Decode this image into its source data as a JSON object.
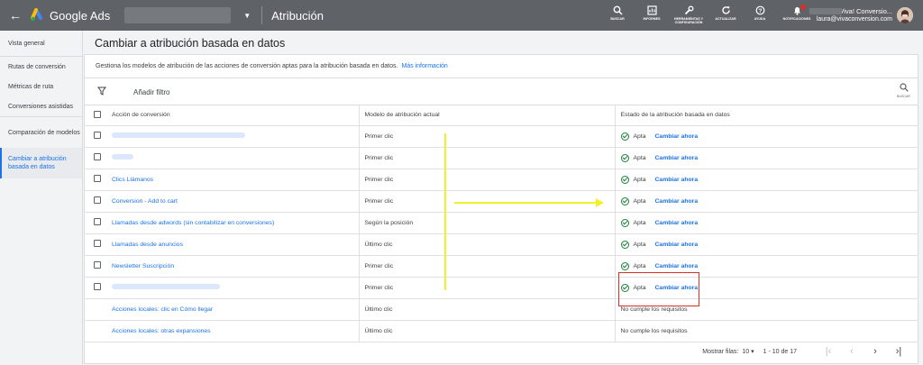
{
  "topbar": {
    "back_icon": "arrow-left-icon",
    "brand": "Google Ads",
    "section_title": "Atribución",
    "tools": [
      {
        "icon": "search-icon",
        "glyph": "🔍",
        "label": "BUSCAR"
      },
      {
        "icon": "reports-icon",
        "glyph": "▤",
        "label": "INFORMES"
      },
      {
        "icon": "tools-icon",
        "glyph": "🔧",
        "label": "HERRAMIENTAS Y CONFIGURACIÓN"
      },
      {
        "icon": "refresh-icon",
        "glyph": "↻",
        "label": "ACTUALIZAR"
      },
      {
        "icon": "help-icon",
        "glyph": "?",
        "label": "AYUDA"
      },
      {
        "icon": "bell-icon",
        "glyph": "🔔",
        "label": "NOTIFICACIONES"
      }
    ],
    "user_name": "Viva! Conversio...",
    "user_email": "laura@vivaconversion.com"
  },
  "sidebar": {
    "items": [
      {
        "label": "Vista general"
      },
      {
        "label": "Rutas de conversión"
      },
      {
        "label": "Métricas de ruta"
      },
      {
        "label": "Conversiones asistidas"
      },
      {
        "label": "Comparación de modelos"
      },
      {
        "label": "Cambiar a atribución basada en datos",
        "active": true
      }
    ]
  },
  "main": {
    "page_title": "Cambiar a atribución basada en datos",
    "banner_text": "Gestiona los modelos de atribución de las acciones de conversión aptas para la atribución basada en datos.",
    "banner_link": "Más información",
    "filter_label": "Añadir filtro",
    "search_label": "BUSCAR",
    "columns": [
      "Acción de conversión",
      "Modelo de atribución actual",
      "Estado de la atribución basada en datos"
    ],
    "rows": [
      {
        "action": "",
        "blur_width": 148,
        "checkbox": true,
        "model": "Primer clic",
        "status": "Apta",
        "change": "Cambiar ahora"
      },
      {
        "action": "",
        "blur_width": 24,
        "checkbox": true,
        "model": "Primer clic",
        "status": "Apta",
        "change": "Cambiar ahora"
      },
      {
        "action": "Clics Llámanos",
        "checkbox": true,
        "model": "Primer clic",
        "status": "Apta",
        "change": "Cambiar ahora"
      },
      {
        "action": "Conversion - Add to cart",
        "checkbox": true,
        "model": "Primer clic",
        "status": "Apta",
        "change": "Cambiar ahora"
      },
      {
        "action": "Llamadas desde adwords (sin contabilizar en conversiones)",
        "checkbox": true,
        "model": "Según la posición",
        "status": "Apta",
        "change": "Cambiar ahora"
      },
      {
        "action": "Llamadas desde anuncios",
        "checkbox": true,
        "model": "Último clic",
        "status": "Apta",
        "change": "Cambiar ahora"
      },
      {
        "action": "Newsletter Suscripción",
        "checkbox": true,
        "model": "Primer clic",
        "status": "Apta",
        "change": "Cambiar ahora"
      },
      {
        "action": "",
        "blur_width": 120,
        "checkbox": true,
        "model": "Primer clic",
        "status": "Apta",
        "change": "Cambiar ahora"
      },
      {
        "action": "Acciones locales: clic en Cómo llegar",
        "checkbox": false,
        "model": "Último clic",
        "status_nc": "No cumple los requisitos"
      },
      {
        "action": "Acciones locales: otras expansiones",
        "checkbox": false,
        "model": "Último clic",
        "status_nc": "No cumple los requisitos"
      }
    ],
    "pager": {
      "rows_label": "Mostrar filas:",
      "rows_value": "10",
      "range": "1 - 10 de 17"
    }
  },
  "colors": {
    "topbar": "#5f6368",
    "link": "#1a73e8",
    "ok_green": "#188038",
    "highlight_red": "#d93025",
    "annotation_yellow": "#f2ef2c"
  }
}
